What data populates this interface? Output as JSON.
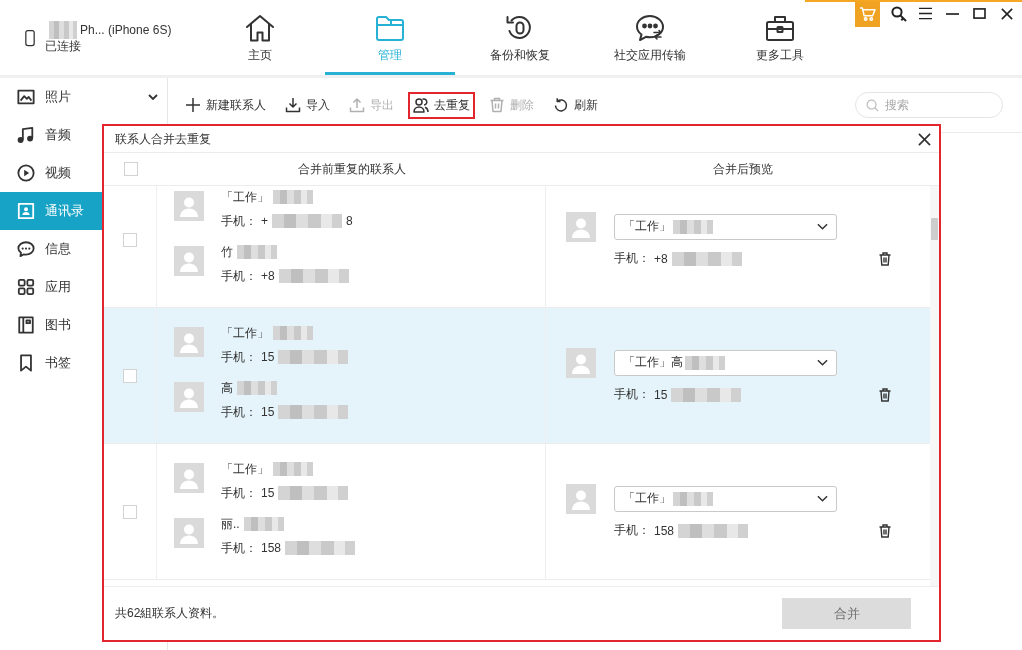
{
  "device": {
    "name": "Ph... (iPhone 6S)",
    "name_redacted": true,
    "status": "已连接"
  },
  "nav_tabs": [
    {
      "label": "主页",
      "selected": false
    },
    {
      "label": "管理",
      "selected": true
    },
    {
      "label": "备份和恢复",
      "selected": false
    },
    {
      "label": "社交应用传输",
      "selected": false
    },
    {
      "label": "更多工具",
      "selected": false
    }
  ],
  "sidebar": {
    "expand_toggle": true,
    "items": [
      {
        "label": "照片",
        "selected": false
      },
      {
        "label": "音频",
        "selected": false
      },
      {
        "label": "视频",
        "selected": false
      },
      {
        "label": "通讯录",
        "selected": true
      },
      {
        "label": "信息",
        "selected": false
      },
      {
        "label": "应用",
        "selected": false
      },
      {
        "label": "图书",
        "selected": false
      },
      {
        "label": "书签",
        "selected": false
      }
    ]
  },
  "toolbar": {
    "buttons": [
      {
        "label": "新建联系人",
        "disabled": false,
        "highlighted": false
      },
      {
        "label": "导入",
        "disabled": false,
        "highlighted": false
      },
      {
        "label": "导出",
        "disabled": true,
        "highlighted": false
      },
      {
        "label": "去重复",
        "disabled": false,
        "highlighted": true
      },
      {
        "label": "删除",
        "disabled": true,
        "highlighted": false
      },
      {
        "label": "刷新",
        "disabled": false,
        "highlighted": false
      }
    ],
    "search": {
      "placeholder": "搜索"
    }
  },
  "dialog": {
    "title": "联系人合并去重复",
    "select_all": {
      "checked": false
    },
    "columns": [
      "合并前重复的联系人",
      "合并后预览"
    ],
    "groups": [
      {
        "selected": false,
        "checked": false,
        "contacts": [
          {
            "name": "「工作」",
            "name_redacted": true,
            "phone_label": "手机：",
            "phone": "+",
            "phone_redacted": true,
            "phone_suffix": "8"
          },
          {
            "name": "竹",
            "name_redacted": true,
            "phone_label": "手机：",
            "phone": "+8",
            "phone_redacted": true
          }
        ],
        "merged": {
          "name": "「工作」",
          "name_redacted": true,
          "phone_label": "手机：",
          "phone": "+8",
          "phone_redacted": true
        }
      },
      {
        "selected": true,
        "checked": false,
        "contacts": [
          {
            "name": "「工作」",
            "name_redacted": true,
            "phone_label": "手机：",
            "phone": "15",
            "phone_redacted": true
          },
          {
            "name": "高",
            "name_redacted": true,
            "phone_label": "手机：",
            "phone": "15",
            "phone_redacted": true
          }
        ],
        "merged": {
          "name": "「工作」高",
          "name_redacted": true,
          "phone_label": "手机：",
          "phone": "15",
          "phone_redacted": true
        }
      },
      {
        "selected": false,
        "checked": false,
        "contacts": [
          {
            "name": "「工作」",
            "name_redacted": true,
            "phone_label": "手机：",
            "phone": "15",
            "phone_redacted": true
          },
          {
            "name": "丽..",
            "name_redacted": true,
            "phone_label": "手机：",
            "phone": "158",
            "phone_redacted": true
          }
        ],
        "merged": {
          "name": "「工作」",
          "name_redacted": true,
          "phone_label": "手机：",
          "phone": "158",
          "phone_redacted": true
        }
      }
    ],
    "summary": "共62組联系人资料。",
    "merge_button": {
      "label": "合并",
      "disabled": true
    }
  }
}
